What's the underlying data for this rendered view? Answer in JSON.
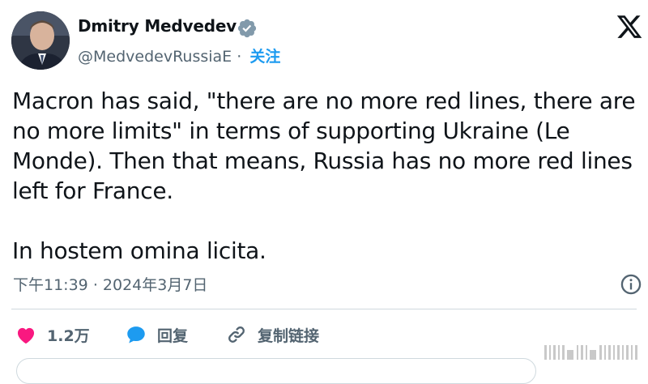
{
  "user": {
    "display_name": "Dmitry Medvedev",
    "handle": "@MedvedevRussiaE",
    "separator": "·",
    "follow_label": "关注"
  },
  "tweet": {
    "paragraph1": "Macron has said, \"there are no more red lines, there are no more limits\" in terms of supporting Ukraine (Le Monde). Then that means, Russia has no more red lines left for France.",
    "paragraph2": "In hostem omina licita.",
    "time": "下午11:39",
    "date": "2024年3月7日",
    "meta_separator": "·"
  },
  "actions": {
    "likes": "1.2万",
    "reply": "回复",
    "copy_link": "复制链接"
  },
  "colors": {
    "accent": "#1d9bf0",
    "like": "#f91880",
    "text": "#0f1419",
    "muted": "#536471",
    "divider": "#cfd9de"
  },
  "icons": {
    "verified": "verified-badge-icon",
    "logo": "x-logo-icon",
    "info": "info-icon",
    "like": "heart-icon",
    "reply": "speech-bubble-icon",
    "link": "link-icon"
  }
}
